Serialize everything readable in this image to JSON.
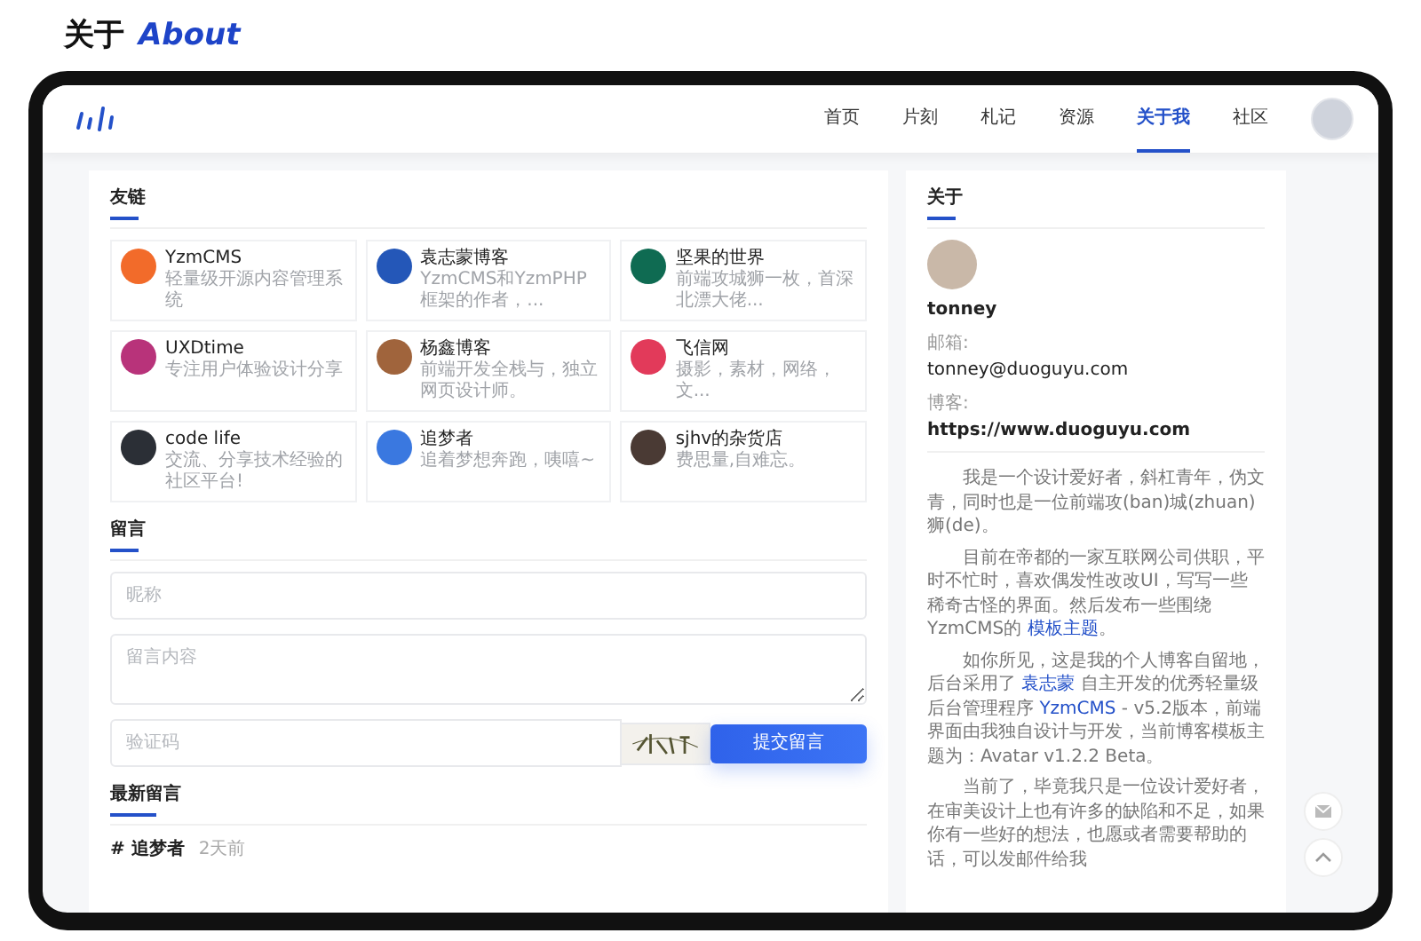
{
  "page_title": {
    "zh": "关于",
    "en": "About"
  },
  "nav": {
    "items": [
      {
        "label": "首页",
        "selected": false
      },
      {
        "label": "片刻",
        "selected": false
      },
      {
        "label": "札记",
        "selected": false
      },
      {
        "label": "资源",
        "selected": false
      },
      {
        "label": "关于我",
        "selected": true
      },
      {
        "label": "社区",
        "selected": false
      }
    ]
  },
  "links": {
    "heading": "友链",
    "items": [
      {
        "name": "YzmCMS",
        "desc": "轻量级开源内容管理系统",
        "color": "#f26b2a"
      },
      {
        "name": "袁志蒙博客",
        "desc": "YzmCMS和YzmPHP框架的作者，...",
        "color": "#2457b8"
      },
      {
        "name": "坚果的世界",
        "desc": "前端攻城狮一枚，首深北漂大佬...",
        "color": "#0f6b52"
      },
      {
        "name": "UXDtime",
        "desc": "专注用户体验设计分享",
        "color": "#b8337a"
      },
      {
        "name": "杨鑫博客",
        "desc": "前端开发全栈与，独立网页设计师。",
        "color": "#a0643c"
      },
      {
        "name": "飞信网",
        "desc": "摄影，素材，网络，文...",
        "color": "#e23a5a"
      },
      {
        "name": "code life",
        "desc": "交流、分享技术经验的社区平台!",
        "color": "#2b2f36"
      },
      {
        "name": "追梦者",
        "desc": "追着梦想奔跑，咦嘻~",
        "color": "#3a78e0"
      },
      {
        "name": "sjhv的杂货店",
        "desc": "费思量,自难忘。",
        "color": "#4a3a34"
      }
    ]
  },
  "message": {
    "heading": "留言",
    "name_placeholder": "昵称",
    "content_placeholder": "留言内容",
    "captcha_placeholder": "验证码",
    "submit": "提交留言"
  },
  "latest": {
    "heading": "最新留言",
    "entries": [
      {
        "author": "# 追梦者",
        "time": "2天前"
      }
    ]
  },
  "about": {
    "heading": "关于",
    "name": "tonney",
    "email_label": "邮箱:",
    "email": "tonney@duoguyu.com",
    "blog_label": "博客:",
    "blog": "https://www.duoguyu.com",
    "paragraphs": [
      "我是一个设计爱好者，斜杠青年，伪文青，同时也是一位前端攻(ban)城(zhuan)狮(de)。",
      "目前在帝都的一家互联网公司供职，平时不忙时，喜欢偶发性改改UI，写写一些稀奇古怪的界面。然后发布一些围绕YzmCMS的 **模板主题**。",
      "如你所见，这是我的个人博客自留地，后台采用了 **袁志蒙** 自主开发的优秀轻量级后台管理程序 **YzmCMS** - v5.2版本，前端界面由我独自设计与开发，当前博客模板主题为：Avatar v1.2.2 Beta。",
      "当前了，毕竟我只是一位设计爱好者，在审美设计上也有许多的缺陷和不足，如果你有一些好的想法，也愿或者需要帮助的话，可以发邮件给我"
    ]
  }
}
